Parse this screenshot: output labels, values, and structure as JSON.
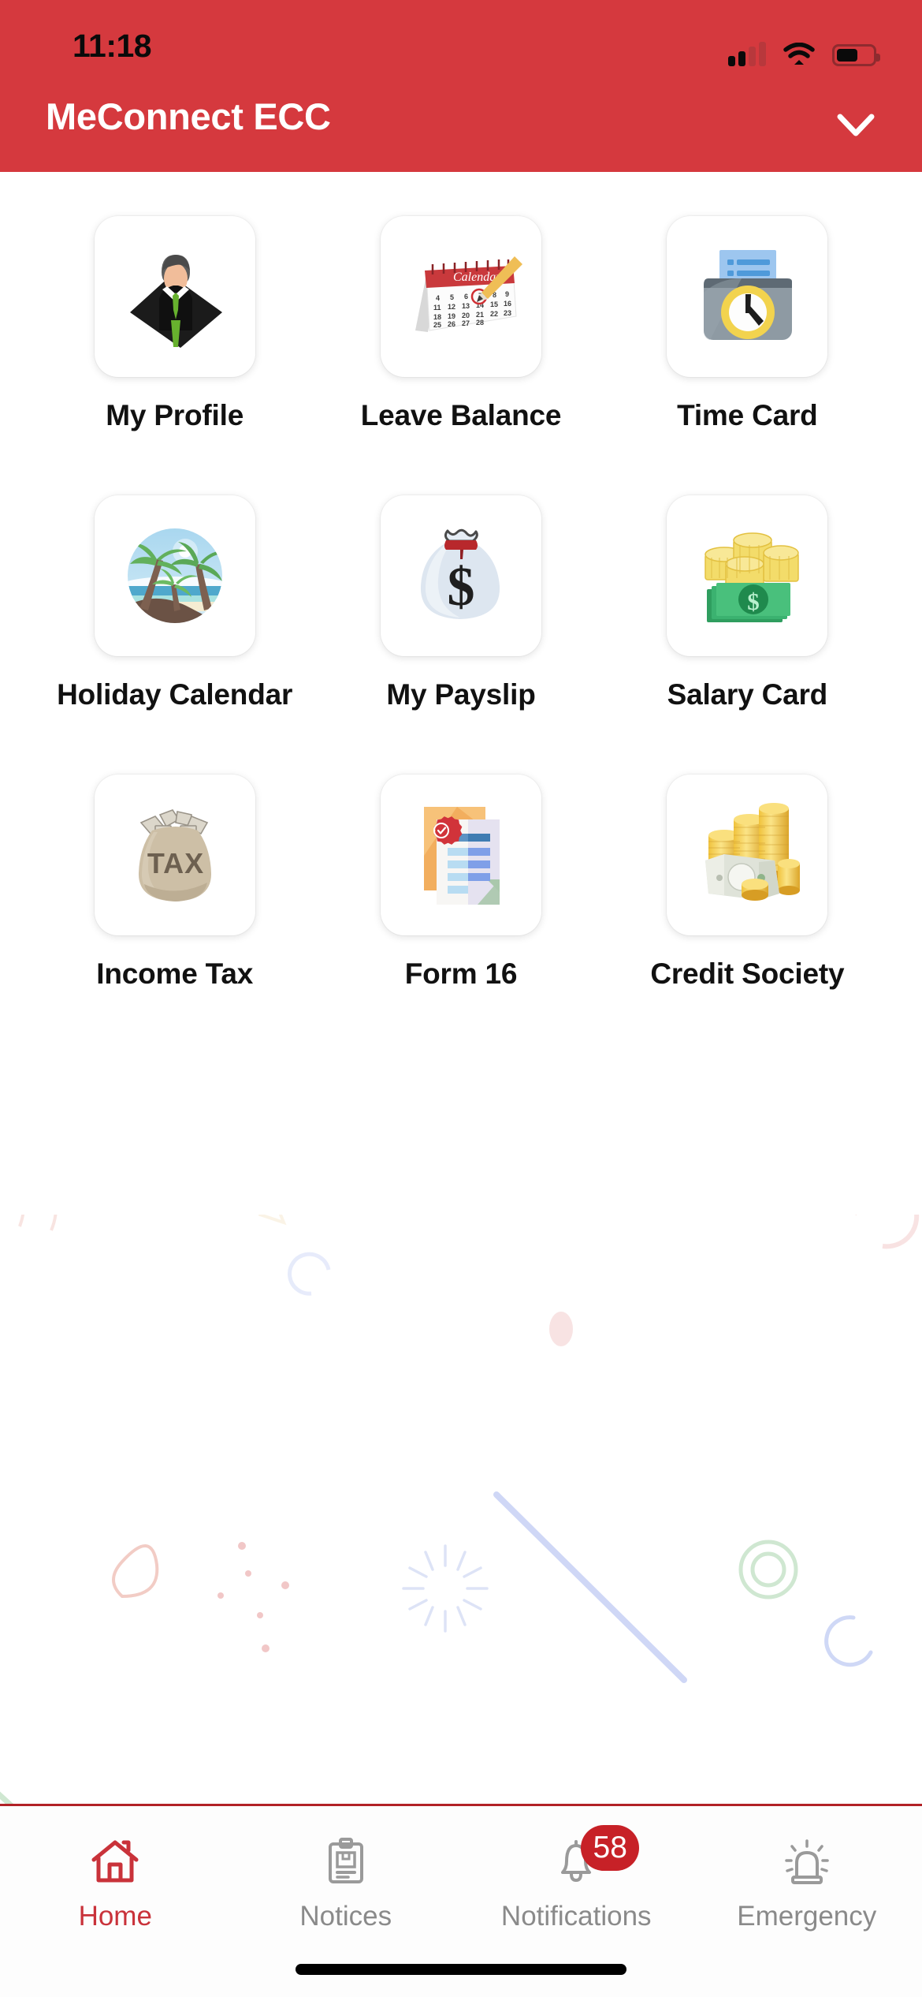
{
  "status_bar": {
    "time": "11:18",
    "signal_icon": "signal-bars-icon",
    "signal_bars_filled": 2,
    "signal_bars_total": 4,
    "wifi_icon": "wifi-icon",
    "battery_icon": "battery-icon",
    "battery_level_percent": 55
  },
  "header": {
    "title": "MeConnect ECC",
    "background_color": "#d5393e",
    "title_color": "#ffffff",
    "chevron_icon": "chevron-down-icon"
  },
  "grid": {
    "tiles": [
      {
        "label": "My Profile",
        "icon": "businessman-profile-icon"
      },
      {
        "label": "Leave Balance",
        "icon": "desk-calendar-pencil-icon",
        "icon_text": "Calendar"
      },
      {
        "label": "Time Card",
        "icon": "time-clock-punch-icon"
      },
      {
        "label": "Holiday Calendar",
        "icon": "beach-palm-tree-icon"
      },
      {
        "label": "My Payslip",
        "icon": "money-bag-dollar-icon",
        "icon_text": "$"
      },
      {
        "label": "Salary Card",
        "icon": "coins-and-banknotes-icon",
        "icon_text": "$"
      },
      {
        "label": "Income Tax",
        "icon": "tax-sack-icon",
        "icon_text": "TAX"
      },
      {
        "label": "Form 16",
        "icon": "certified-document-icon"
      },
      {
        "label": "Credit Society",
        "icon": "coin-stacks-banknote-icon"
      }
    ]
  },
  "bottom_nav": {
    "active_color": "#c9323a",
    "inactive_color": "#8a8a8a",
    "items": [
      {
        "label": "Home",
        "icon": "home-icon",
        "active": true,
        "badge": ""
      },
      {
        "label": "Notices",
        "icon": "clipboard-icon",
        "active": false,
        "badge": ""
      },
      {
        "label": "Notifications",
        "icon": "bell-icon",
        "active": false,
        "badge": "58"
      },
      {
        "label": "Emergency",
        "icon": "siren-alarm-icon",
        "active": false,
        "badge": ""
      }
    ]
  },
  "system": {
    "home_indicator": "home-indicator-bar"
  }
}
